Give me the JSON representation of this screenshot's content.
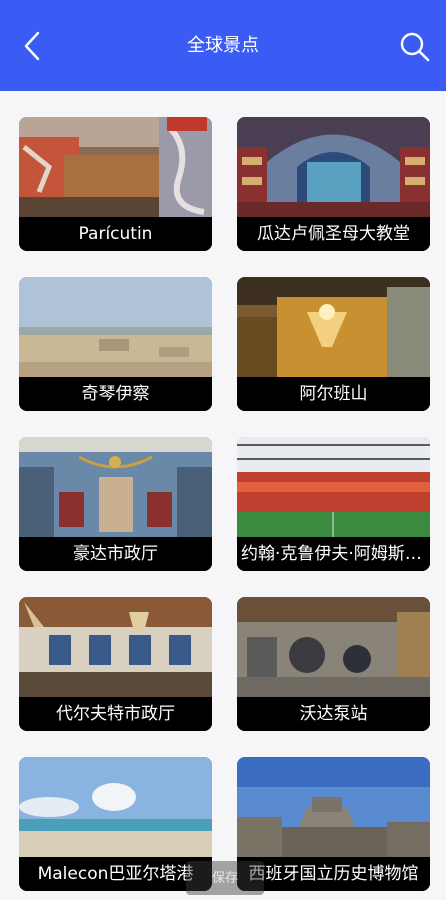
{
  "header": {
    "title": "全球景点",
    "back_icon": "chevron-left-icon",
    "search_icon": "search-icon",
    "accent_color": "#3a5cf5"
  },
  "places": [
    {
      "name": "Parícutin"
    },
    {
      "name": "瓜达卢佩圣母大教堂"
    },
    {
      "name": "奇琴伊察"
    },
    {
      "name": "阿尔班山"
    },
    {
      "name": "豪达市政厅"
    },
    {
      "name": "约翰·克鲁伊夫·阿姆斯特丹竞技场"
    },
    {
      "name": "代尔夫特市政厅"
    },
    {
      "name": "沃达泵站"
    },
    {
      "name": "Malecon巴亚尔塔港"
    },
    {
      "name": "西班牙国立历史博物馆"
    }
  ],
  "overlay": {
    "save_label": "保存"
  }
}
